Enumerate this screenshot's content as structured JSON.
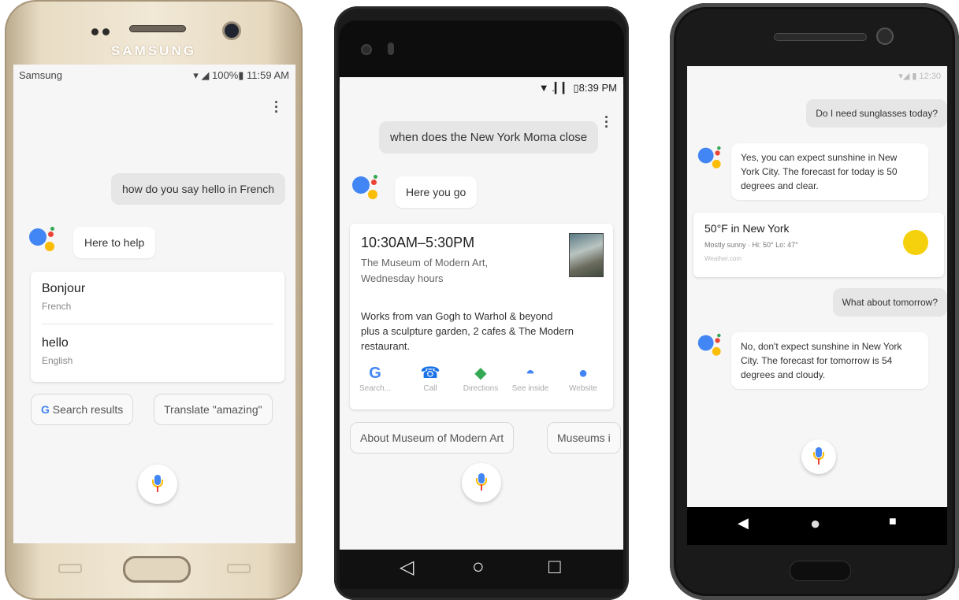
{
  "phone1": {
    "brand": "SAMSUNG",
    "status_left": "Samsung",
    "status_right": "▾ ◢ 100%▮ 11:59 AM",
    "user_message": "how do you say hello in French",
    "assistant_message": "Here to help",
    "card": [
      {
        "word": "Bonjour",
        "language": "French"
      },
      {
        "word": "hello",
        "language": "English"
      }
    ],
    "chips": [
      "Search results",
      "Translate \"amazing\""
    ]
  },
  "phone2": {
    "status_right": "▼ .▎▎ ▯8:39 PM",
    "user_message": "when does the New York Moma close",
    "assistant_message": "Here you go",
    "card": {
      "hours": "10:30AM–5:30PM",
      "place_line1": "The Museum of Modern Art,",
      "place_line2": "Wednesday hours",
      "description_line1": "Works from van Gogh to Warhol & beyond",
      "description_line2": "plus a sculpture garden, 2 cafes & The Modern",
      "description_line3": "restaurant.",
      "actions": [
        {
          "glyph": "G",
          "label": "Search...",
          "color": "#4285f4"
        },
        {
          "glyph": "☎",
          "label": "Call",
          "color": "#1a73e8"
        },
        {
          "glyph": "◆",
          "label": "Directions",
          "color": "#34a853"
        },
        {
          "glyph": "◓",
          "label": "See inside",
          "color": "#4285f4"
        },
        {
          "glyph": "●",
          "label": "Website",
          "color": "#4285f4"
        }
      ]
    },
    "chips": [
      "About Museum of Modern Art",
      "Museums i"
    ],
    "nav": {
      "back": "◁",
      "home": "○",
      "recents": "□"
    }
  },
  "phone3": {
    "status_right": "▾◢ ▮ 12:30",
    "user_message_1": "Do I need sunglasses today?",
    "assistant_message_1_line1": "Yes, you can expect sunshine in New",
    "assistant_message_1_line2": "York City. The forecast for today is 50",
    "assistant_message_1_line3": "degrees and clear.",
    "weather_card": {
      "title": "50°F in New York",
      "subtitle": "Mostly sunny · Hi: 50° Lo: 47°",
      "source": "Weather.com",
      "sun_color": "#f5d10d"
    },
    "user_message_2": "What about tomorrow?",
    "assistant_message_2_line1": "No, don't expect sunshine in New York",
    "assistant_message_2_line2": "City. The forecast for tomorrow is 54",
    "assistant_message_2_line3": "degrees and cloudy.",
    "nav": {
      "back": "◀",
      "home": "●",
      "recents": "■"
    }
  }
}
